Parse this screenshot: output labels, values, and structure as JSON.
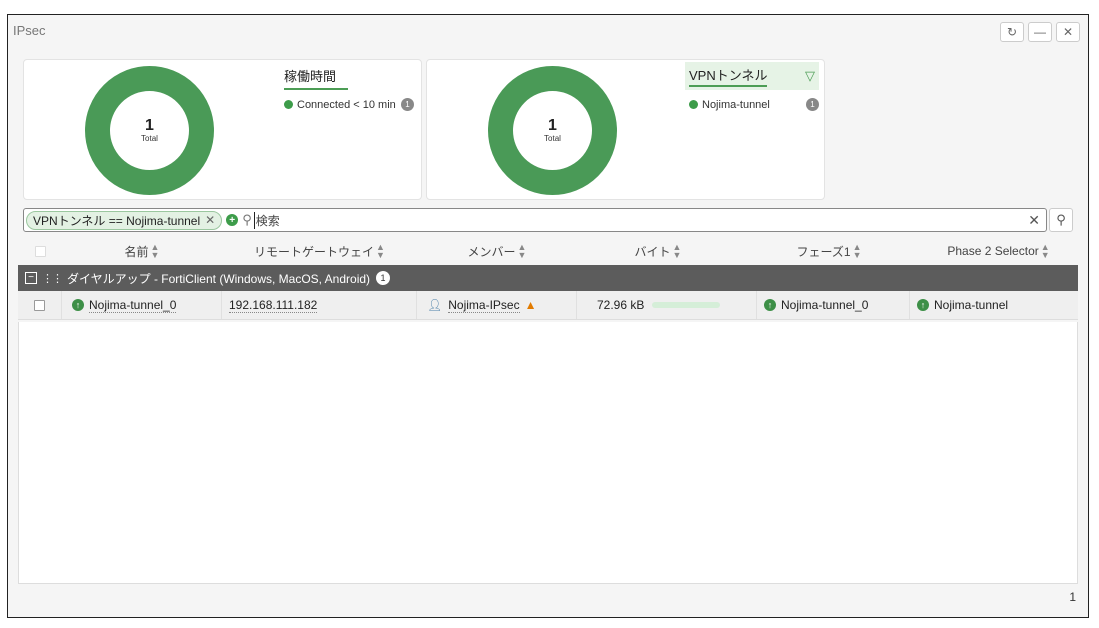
{
  "window": {
    "title": "IPsec",
    "buttons": [
      "refresh",
      "minimize",
      "close"
    ]
  },
  "cards": [
    {
      "donut_value": "1",
      "donut_label": "Total",
      "legend_title": "稼働時間",
      "legend_items": [
        {
          "label": "Connected < 10 min",
          "count": "1",
          "color": "#3d9c4a"
        }
      ]
    },
    {
      "donut_value": "1",
      "donut_label": "Total",
      "legend_title": "VPNトンネル",
      "legend_items": [
        {
          "label": "Nojima-tunnel",
          "count": "1",
          "color": "#3d9c4a"
        }
      ]
    }
  ],
  "search": {
    "filter_chip": "VPNトンネル == Nojima-tunnel",
    "value": "検索"
  },
  "table": {
    "columns": [
      "名前",
      "リモートゲートウェイ",
      "メンバー",
      "バイト",
      "フェーズ1",
      "Phase 2 Selector"
    ],
    "group_label": "ダイヤルアップ - FortiClient (Windows, MacOS, Android)",
    "group_count": "1",
    "rows": [
      {
        "name": "Nojima-tunnel_0",
        "remote_gateway": "192.168.111.182",
        "member": "Nojima-IPsec",
        "bytes": "72.96 kB",
        "phase1": "Nojima-tunnel_0",
        "phase2_selector": "Nojima-tunnel"
      }
    ]
  },
  "footer": {
    "page": "1"
  },
  "colors": {
    "accent": "#3d9c4a",
    "group_header": "#5c5c5c"
  }
}
